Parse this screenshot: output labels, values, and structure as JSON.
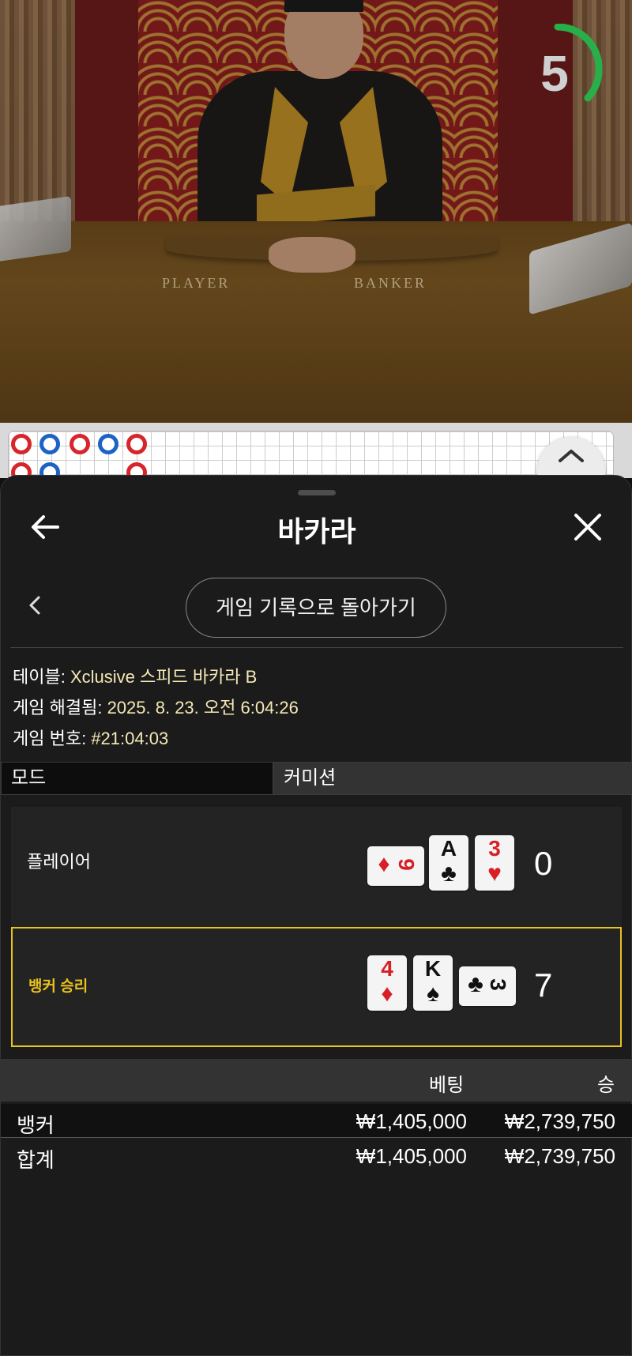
{
  "video": {
    "table_label_player": "PLAYER",
    "table_label_banker": "BANKER",
    "timer_value": "5",
    "timer_color": "#27b04a"
  },
  "roadmap": {
    "beads": [
      "red",
      "blue",
      "red",
      "blue",
      "red",
      "red",
      "blue",
      "red"
    ],
    "expand_icon": "chevron-up-icon"
  },
  "sheet": {
    "title": "바카라",
    "back_icon": "arrow-left-icon",
    "close_icon": "close-icon",
    "prev_icon": "chevron-left-icon",
    "back_to_history_label": "게임 기록으로 돌아가기",
    "info": {
      "table_label": "테이블:",
      "table_value": "Xclusive 스피드 바카라 B",
      "resolved_label": "게임 해결됨:",
      "resolved_value": "2025. 8. 23. 오전 6:04:26",
      "game_no_label": "게임 번호:",
      "game_no_value": "#21:04:03"
    },
    "mode_label": "모드",
    "mode_value": "커미션",
    "player": {
      "label": "플레이어",
      "score": "0",
      "cards": [
        {
          "rank": "9",
          "suit": "♦",
          "color": "#d81f26",
          "sideways": true
        },
        {
          "rank": "A",
          "suit": "♣",
          "color": "#111111",
          "sideways": false
        },
        {
          "rank": "3",
          "suit": "♥",
          "color": "#d81f26",
          "sideways": false
        }
      ]
    },
    "banker": {
      "label": "뱅커 승리",
      "label_color": "#e8c21e",
      "score": "7",
      "cards": [
        {
          "rank": "4",
          "suit": "♦",
          "color": "#d81f26",
          "sideways": false
        },
        {
          "rank": "K",
          "suit": "♠",
          "color": "#111111",
          "sideways": false
        },
        {
          "rank": "3",
          "suit": "♣",
          "color": "#111111",
          "sideways": true
        }
      ]
    },
    "bets": {
      "col_bet": "베팅",
      "col_win": "승",
      "rows": [
        {
          "name": "뱅커",
          "bet": "₩1,405,000",
          "win": "₩2,739,750"
        },
        {
          "name": "합계",
          "bet": "₩1,405,000",
          "win": "₩2,739,750"
        }
      ]
    }
  }
}
